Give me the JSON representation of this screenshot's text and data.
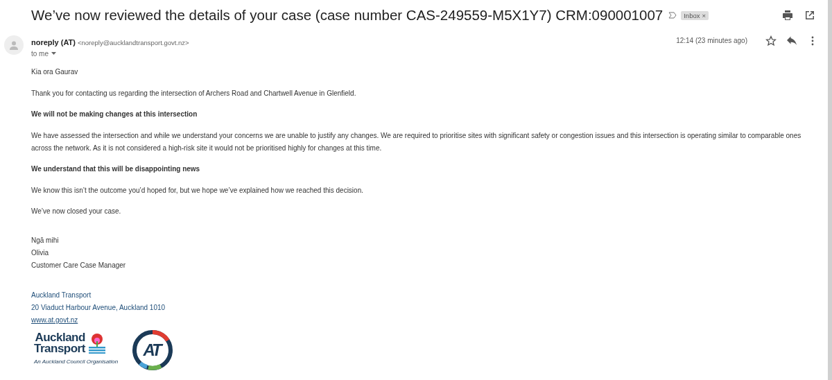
{
  "subject": "We’ve now reviewed the details of your case (case number CAS-249559-M5X1Y7) CRM:090001007",
  "label_badge": {
    "text": "Inbox",
    "close": "×"
  },
  "sender": {
    "name": "noreply (AT)",
    "email": "<noreply@aucklandtransport.govt.nz>",
    "to": "to me",
    "time": "12:14 (23 minutes ago)",
    "starred": false
  },
  "body": [
    {
      "kind": "text",
      "text": "Kia ora Gaurav"
    },
    {
      "kind": "text",
      "text": "Thank you for contacting us regarding the intersection of Archers Road and Chartwell Avenue in Glenfield."
    },
    {
      "kind": "heading",
      "text": "We will not be making changes at this intersection"
    },
    {
      "kind": "text",
      "text": "We have assessed the intersection and while we understand your concerns we are unable to justify any changes. We are required to prioritise sites with significant safety or congestion issues and this intersection is operating similar to comparable ones across the network. As it is not considered a high-risk site it would not be prioritised highly for changes at this time."
    },
    {
      "kind": "heading",
      "text": "We understand that this will be disappointing news"
    },
    {
      "kind": "text",
      "text": "We know this isn’t the outcome you’d hoped for, but we hope we’ve explained how we reached this decision."
    },
    {
      "kind": "text",
      "text": "We’ve now closed your case."
    }
  ],
  "signoff": [
    "Ngā mihi",
    "Olivia",
    "Customer Care Case Manager"
  ],
  "contact": {
    "org": "Auckland Transport",
    "address": "20 Viaduct Harbour Avenue, Auckland 1010",
    "link": "www.at.govt.nz"
  },
  "logo": {
    "line1": "Auckland",
    "line2": "Transport",
    "tagline": "An Auckland Council Organisation",
    "roundel": "AT"
  }
}
